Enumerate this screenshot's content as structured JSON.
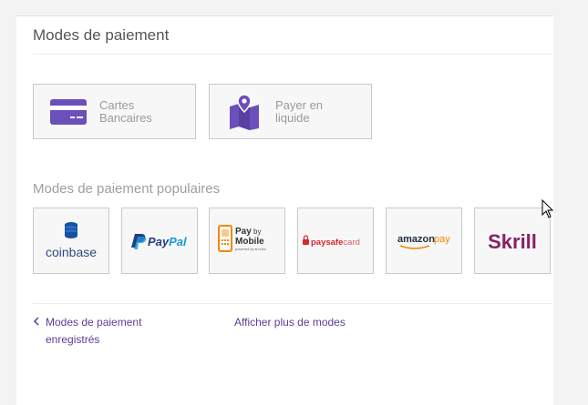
{
  "panel": {
    "title": "Modes de paiement"
  },
  "methods": [
    {
      "name": "card",
      "label": "Cartes Bancaires",
      "icon": "credit-card-icon"
    },
    {
      "name": "cash",
      "label": "Payer en liquide",
      "icon": "map-pin-icon"
    }
  ],
  "popular": {
    "title": "Modes de paiement populaires",
    "providers": [
      {
        "name": "coinbase",
        "label": "coinbase",
        "icon": "coin-stack-icon"
      },
      {
        "name": "paypal",
        "label_pay": "Pay",
        "label_pal": "Pal",
        "icon": "paypal-p-icon"
      },
      {
        "name": "paybymobile",
        "label_pay": "Pay",
        "label_by": "by",
        "label_mobile": "Mobile",
        "label_powered": "powered by ● boku",
        "icon": "mobile-phone-icon"
      },
      {
        "name": "paysafecard",
        "label_pay": "paysafe",
        "label_card": "card",
        "icon": "padlock-icon"
      },
      {
        "name": "amazonpay",
        "label_amazon": "amazon",
        "label_pay": "pay"
      },
      {
        "name": "skrill",
        "label": "Skrill"
      }
    ]
  },
  "footer": {
    "saved_link": "Modes de paiement enregistrés",
    "more_link": "Afficher plus de modes"
  },
  "colors": {
    "accent": "#6b4fbb",
    "link": "#5b3e94",
    "paypal_dark": "#253b80",
    "paypal_light": "#179bd7",
    "coinbase": "#1652a3",
    "paysafe_red": "#d7262f",
    "amazon_orange": "#f08804",
    "skrill": "#862165"
  }
}
